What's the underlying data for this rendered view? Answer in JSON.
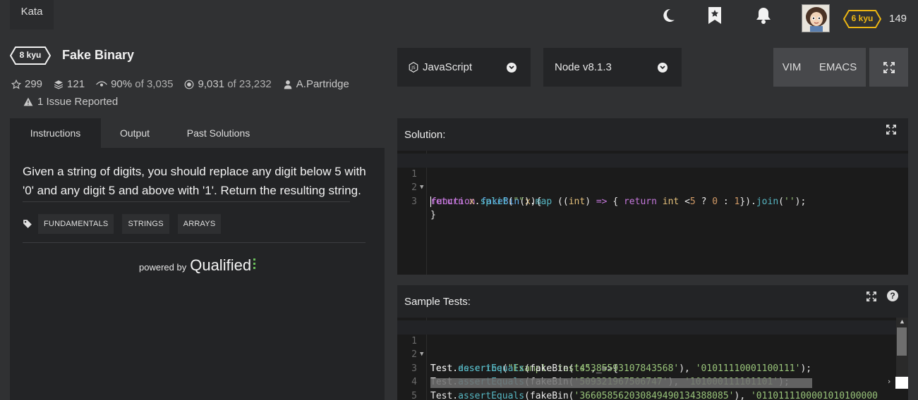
{
  "topbar": {
    "kata_tab": "Kata",
    "honor": "149",
    "user_rank": "6 kyu",
    "icons": [
      "moon-icon",
      "bookmark-star-icon",
      "bell-icon",
      "avatar",
      "rank-badge"
    ]
  },
  "kata": {
    "rank": "8 kyu",
    "title": "Fake Binary",
    "stars": "299",
    "collections": "121",
    "satisfaction": "90%",
    "satisfaction_of": "of 3,035",
    "completed": "9,031",
    "completed_of": "of 23,232",
    "author": "A.Partridge",
    "issues": "1 Issue Reported"
  },
  "editor_toolbar": {
    "language": "JavaScript",
    "runtime": "Node v8.1.3",
    "vim": "VIM",
    "emacs": "EMACS"
  },
  "left_panel": {
    "tabs": [
      "Instructions",
      "Output",
      "Past Solutions"
    ],
    "active_tab": "Instructions",
    "description": "Given a string of digits, you should replace any digit below 5 with '0' and any digit 5 and above with '1'. Return the resulting string.",
    "tags": [
      "FUNDAMENTALS",
      "STRINGS",
      "ARRAYS"
    ],
    "powered_by": "powered by",
    "brand": "Qualified"
  },
  "solution": {
    "title": "Solution:",
    "line_numbers": [
      "1",
      "2",
      "3"
    ],
    "lines": [
      "function fakeBin(x){",
      "return x.split(\"\").map ((int) => { return int <5 ? 0 : 1}).join('');",
      "}"
    ]
  },
  "sample_tests": {
    "title": "Sample Tests:",
    "line_numbers": [
      "1",
      "2",
      "3",
      "4",
      "5"
    ],
    "lines": [
      "Test.describe(\"Example tests\",_=>{",
      "Test.assertEquals(fakeBin('45385593107843568'), '01011110001100111');",
      "Test.assertEquals(fakeBin('509321967506747'), '101000111101101');",
      "Test.assertEquals(fakeBin('366058562030849490134388085'), '0110111100001010100000",
      "});"
    ]
  },
  "colors": {
    "background": "#303133",
    "panel": "#232426",
    "editor": "#1b1b1b",
    "rank_yellow": "#ecb613",
    "qualified_green": "#6bbf5b"
  }
}
